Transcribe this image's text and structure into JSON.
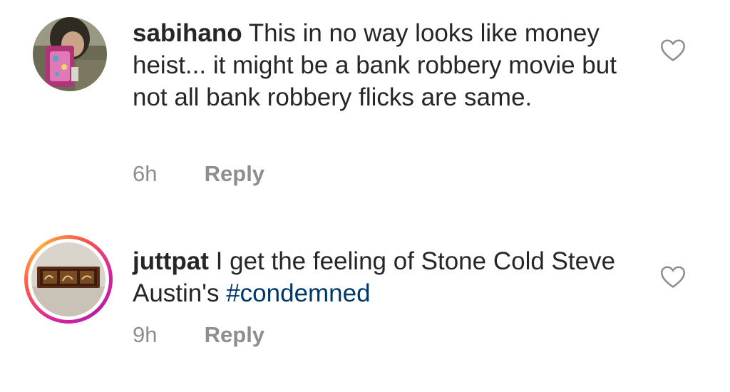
{
  "comments": [
    {
      "username": "sabihano",
      "text": "This in no way looks like money heist... it might be a bank robbery movie but not all bank robbery flicks are same.",
      "hashtag": "",
      "time": "6h",
      "reply_label": "Reply",
      "avatar_icon": "profile-photo",
      "like_icon": "heart-outline-icon"
    },
    {
      "username": "juttpat",
      "text": "I get the feeling of Stone Cold Steve Austin's",
      "hashtag": "#condemned",
      "time": "9h",
      "reply_label": "Reply",
      "avatar_icon": "calligraphy-frame-photo",
      "like_icon": "heart-outline-icon",
      "story_ring": true
    }
  ],
  "colors": {
    "text": "#262626",
    "secondary": "#8e8e8e",
    "hashtag": "#00376b",
    "story_ring": [
      "#d6249f",
      "#fd5949",
      "#fdae3c"
    ]
  }
}
